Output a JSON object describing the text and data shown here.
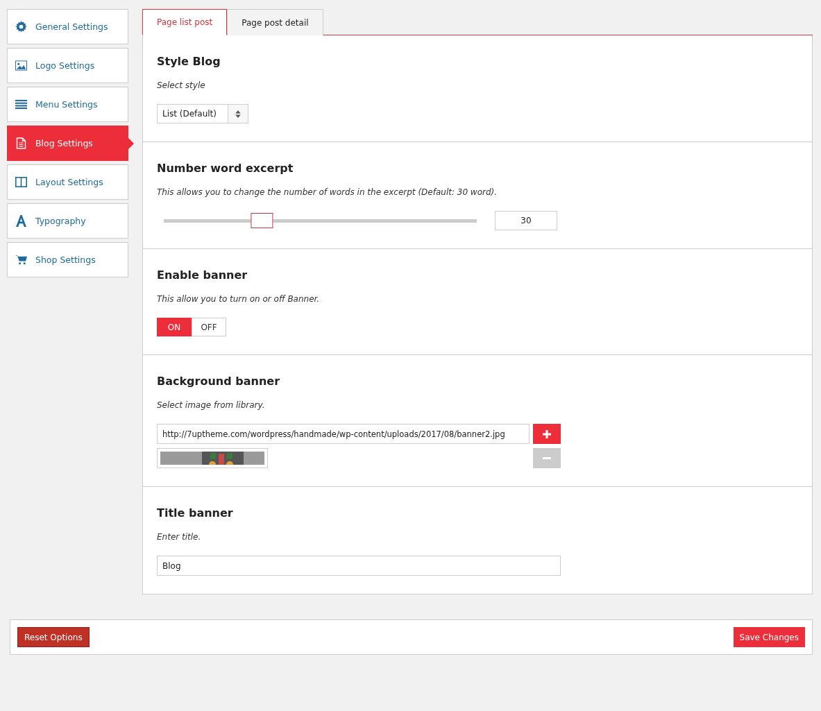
{
  "sidebar": {
    "items": [
      {
        "label": "General Settings",
        "kind": "gear",
        "selected": false
      },
      {
        "label": "Logo Settings",
        "kind": "image",
        "selected": false
      },
      {
        "label": "Menu Settings",
        "kind": "menu",
        "selected": false
      },
      {
        "label": "Blog Settings",
        "kind": "document",
        "selected": true
      },
      {
        "label": "Layout Settings",
        "kind": "columns",
        "selected": false
      },
      {
        "label": "Typography",
        "kind": "letter",
        "selected": false
      },
      {
        "label": "Shop Settings",
        "kind": "cart",
        "selected": false
      }
    ]
  },
  "tabs": [
    {
      "label": "Page list post",
      "selected": true
    },
    {
      "label": "Page post detail",
      "selected": false
    }
  ],
  "sections": [
    {
      "kind": "select",
      "title": "Style Blog",
      "description": "Select style",
      "value": "List (Default)"
    },
    {
      "kind": "slider",
      "title": "Number word excerpt",
      "description": "This allows you to change the number of words in the excerpt (Default: 30 word).",
      "level": 0.3,
      "value": "30"
    },
    {
      "kind": "toggle",
      "title": "Enable banner",
      "description": "This allow you to turn on or off Banner.",
      "options": [
        {
          "label": "ON",
          "selected": true
        },
        {
          "label": "OFF",
          "selected": false
        }
      ]
    },
    {
      "kind": "image",
      "title": "Background banner",
      "description": "Select image from library.",
      "value": "http://7uptheme.com/wordpress/handmade/wp-content/uploads/2017/08/banner2.jpg",
      "remove_disabled": true
    },
    {
      "kind": "text",
      "title": "Title banner",
      "description": "Enter title.",
      "value": "Blog"
    }
  ],
  "footer": {
    "reset": "Reset Options",
    "save": "Save Changes"
  }
}
